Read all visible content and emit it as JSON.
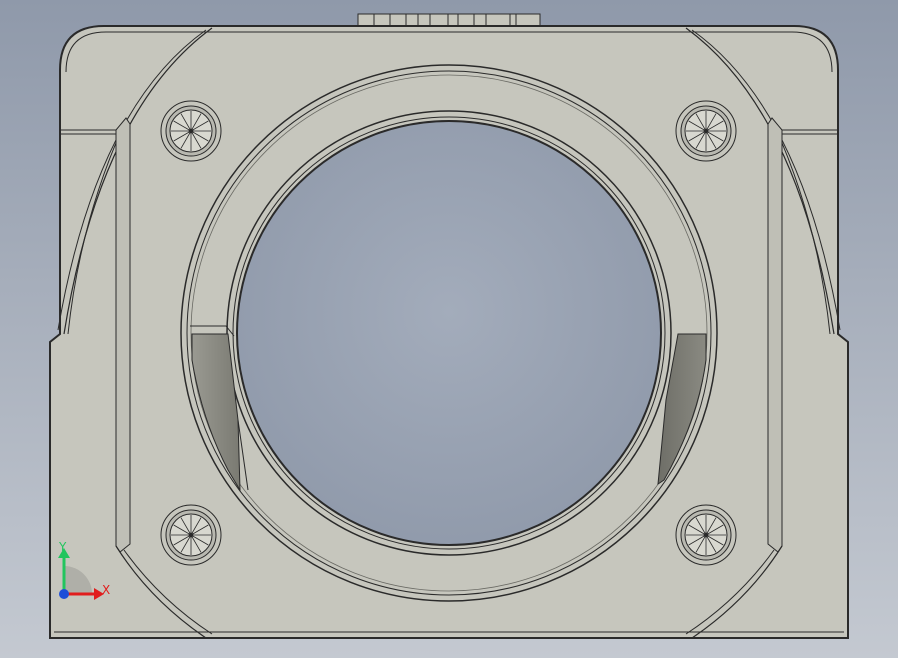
{
  "colors": {
    "background_top": "#8f99aa",
    "background_bottom": "#c4c9d1",
    "part_face": "#c6c6bd",
    "part_face_dark": "#a8a8a0",
    "edge": "#2a2a2a",
    "insert_dark": "#7a7a72",
    "insert_mid": "#9a9a92",
    "screw_head": "#b8b8b0",
    "axis_x": "#e11d1d",
    "axis_y": "#22c55e",
    "axis_origin": "#1d4ed8"
  },
  "axes": {
    "x_label": "X",
    "y_label": "Y"
  },
  "screws": {
    "count": 4,
    "icon": "screw-head-icon"
  }
}
